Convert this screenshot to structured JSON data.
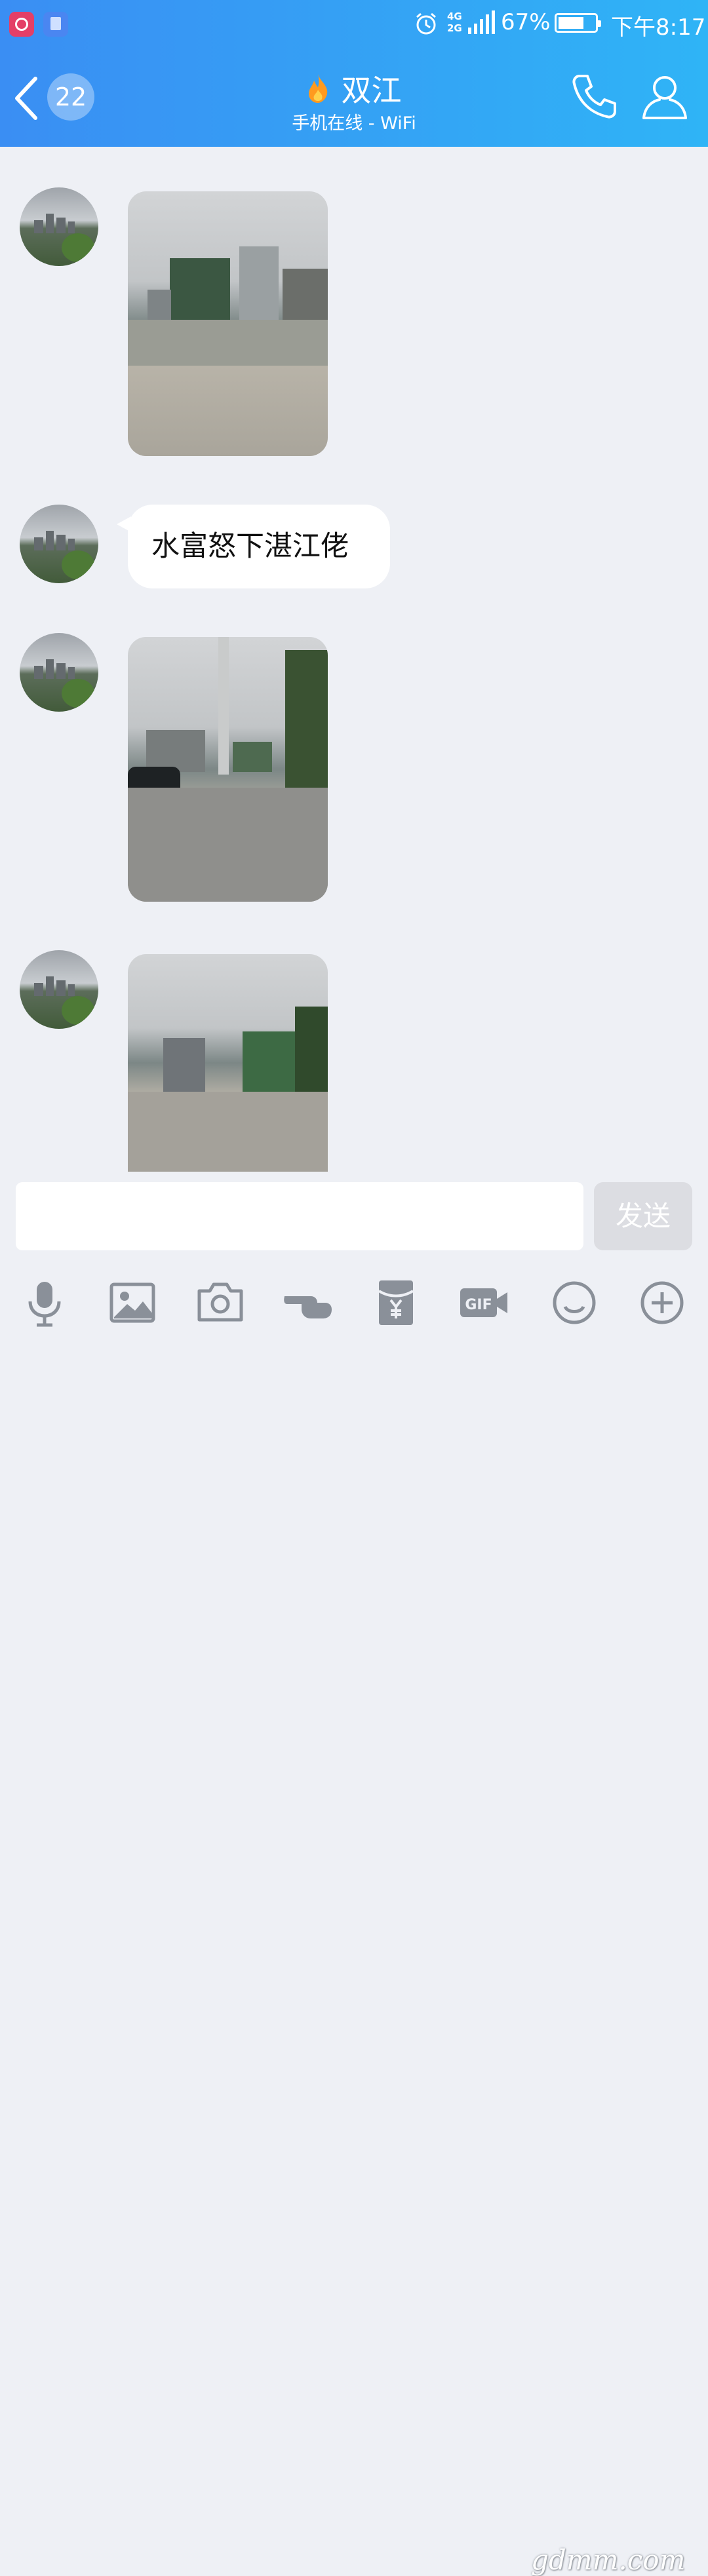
{
  "status_bar": {
    "network": "4G\n2G",
    "battery": "67%",
    "time": "下午8:17"
  },
  "header": {
    "unread_count": "22",
    "contact_name": "双江",
    "contact_status": "手机在线 - WiFi"
  },
  "messages": [
    {
      "type": "image",
      "description_icon": "photo"
    },
    {
      "type": "text",
      "text": "水富怒下湛江佬"
    },
    {
      "type": "image",
      "description_icon": "photo"
    },
    {
      "type": "image",
      "description_icon": "photo"
    }
  ],
  "composer": {
    "input_value": "",
    "send_label": "发送"
  },
  "toolbar_icons": [
    "microphone-icon",
    "image-icon",
    "camera-icon",
    "poke-icon",
    "red-packet-icon",
    "gif-icon",
    "emoji-icon",
    "plus-icon"
  ],
  "watermark": "gdmm.com",
  "colors": {
    "header_start": "#3a8ef3",
    "header_end": "#2fb4f6",
    "background": "#eef0f5",
    "send_disabled": "#dcdde2"
  }
}
